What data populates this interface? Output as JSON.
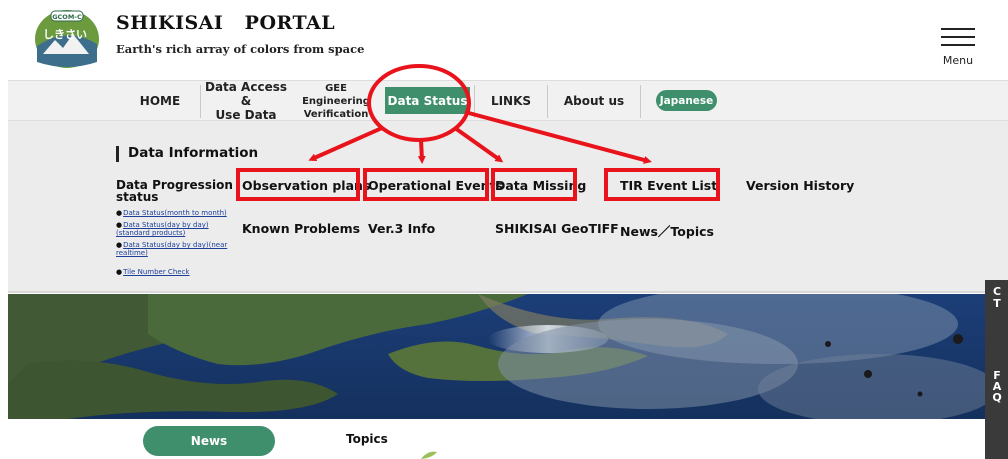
{
  "header": {
    "title": "SHIKISAI   PORTAL",
    "subtitle": "Earth's rich array of colors from space",
    "logo_text": "しきさい",
    "logo_badge": "GCOM-C",
    "logo_icon": "shikisai-logo-icon",
    "menu_label": "Menu",
    "menu_icon": "hamburger-icon"
  },
  "nav": {
    "home": "HOME",
    "data_access_line1": "Data Access &",
    "data_access_line2": "Use Data",
    "gee_line1": "GEE Engineering",
    "gee_line2": "Verification",
    "data_status": "Data Status",
    "links": "LINKS",
    "about": "About us",
    "japanese": "Japanese"
  },
  "dropdown": {
    "heading": "Data Information",
    "progress_line1": "Data Progression",
    "progress_line2": "status",
    "progress_subs": [
      "Data Status(month to month)",
      "Data Status(day by day)(standard products)",
      "Data Status(day by day)(near realtime)",
      "Tile Number Check"
    ],
    "sub1": "Data Status(month to month)",
    "sub2a": "Data Status(day by day)",
    "sub2b": "(standard products)",
    "sub3a": "Data Status(day by day)(near",
    "sub3b": "realtime)",
    "sub4": "Tile Number Check",
    "observation_plans": "Observation plans",
    "operational_events": "Operational Events",
    "data_missing": "Data Missing",
    "tir_event_list": "TIR Event List",
    "version_history": "Version History",
    "known_problems": "Known Problems",
    "ver3_info": "Ver.3 Info",
    "geotiff": "SHIKISAI GeoTIFF",
    "news_topics": "News／Topics"
  },
  "side_tab": {
    "line1": [
      "C",
      "T"
    ],
    "line2": [
      "F",
      "A",
      "Q"
    ]
  },
  "tabs": {
    "news": "News",
    "topics": "Topics"
  },
  "colors": {
    "accent_green": "#3f8e6c",
    "annotation_red": "#e8131b"
  }
}
